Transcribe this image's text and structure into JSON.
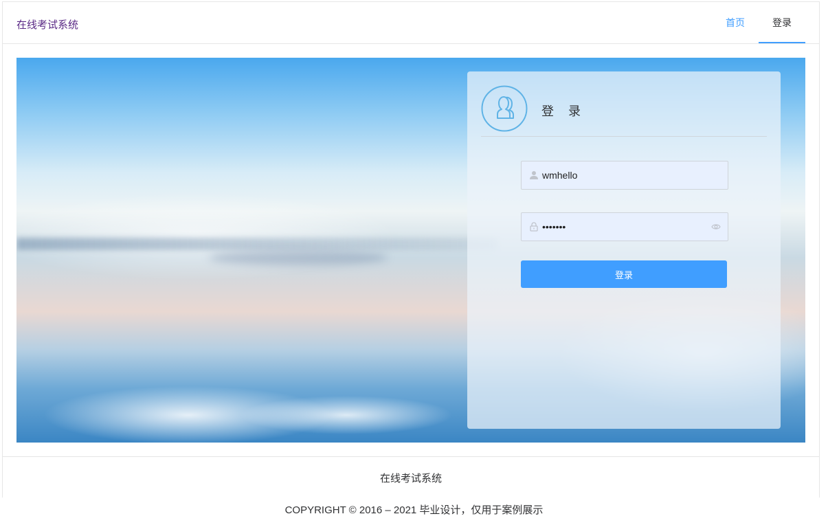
{
  "header": {
    "brand": "在线考试系统",
    "nav": [
      {
        "label": "首页",
        "active": false
      },
      {
        "label": "登录",
        "active": true
      }
    ]
  },
  "login": {
    "title": "登 录",
    "username": {
      "value": "wmhello",
      "icon": "user-icon"
    },
    "password": {
      "value": "wmhello",
      "icon": "lock-icon",
      "toggle_icon": "eye-icon"
    },
    "submit_label": "登录",
    "avatar_icon": "users-icon"
  },
  "footer": {
    "title": "在线考试系统",
    "copyright": "COPYRIGHT © 2016 – 2021 毕业设计，仅用于案例展示"
  },
  "colors": {
    "accent": "#409eff",
    "brand": "#5b2a86",
    "avatar_stroke": "#5fb3e6"
  }
}
